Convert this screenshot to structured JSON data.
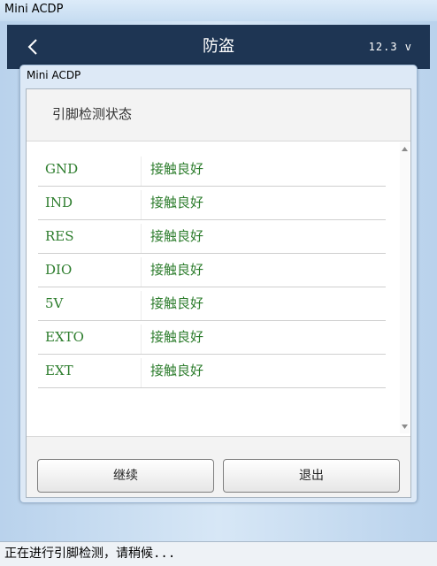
{
  "window": {
    "title": "Mini ACDP"
  },
  "header": {
    "title": "防盗",
    "voltage": "12.3 v"
  },
  "dialog": {
    "title": "Mini ACDP",
    "heading": "引脚检测状态",
    "rows": [
      {
        "pin": "GND",
        "status": "接触良好"
      },
      {
        "pin": "IND",
        "status": "接触良好"
      },
      {
        "pin": "RES",
        "status": "接触良好"
      },
      {
        "pin": "DIO",
        "status": "接触良好"
      },
      {
        "pin": "5V",
        "status": "接触良好"
      },
      {
        "pin": "EXTO",
        "status": "接触良好"
      },
      {
        "pin": "EXT",
        "status": "接触良好"
      }
    ],
    "buttons": {
      "continue_label": "继续",
      "exit_label": "退出"
    }
  },
  "statusbar": {
    "text": "正在进行引脚检测，请稍候..."
  },
  "colors": {
    "header_bg": "#1e3553",
    "status_green": "#2d7d2d"
  },
  "icons": {
    "back": "chevron-left-icon",
    "scroll_up": "triangle-up-icon",
    "scroll_down": "triangle-down-icon"
  }
}
